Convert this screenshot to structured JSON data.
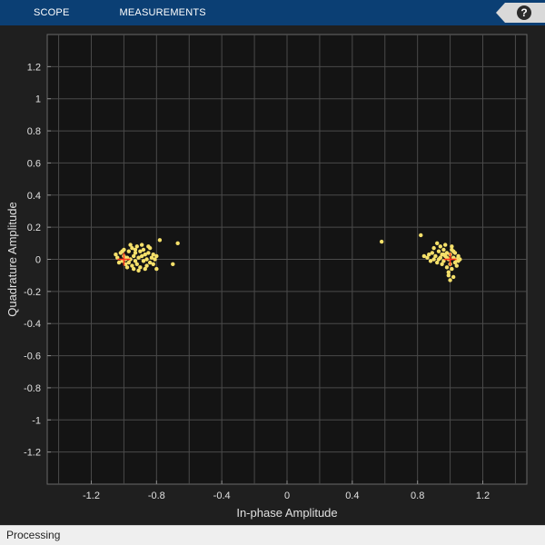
{
  "toolbar": {
    "tabs": [
      {
        "label": "SCOPE"
      },
      {
        "label": "MEASUREMENTS"
      }
    ],
    "help_label": "?",
    "help_icon": "help-icon"
  },
  "status": {
    "text": "Processing"
  },
  "colors": {
    "toolbar_bg": "#0b3f74",
    "plot_bg": "#141414",
    "figure_bg": "#1f1f1f",
    "grid": "#4a4a4a",
    "axis_text": "#e0e0e0",
    "points": "#f5e06a",
    "reference": "#ff3b1f"
  },
  "chart_data": {
    "type": "scatter",
    "xlabel": "In-phase Amplitude",
    "ylabel": "Quadrature Amplitude",
    "xlim": [
      -1.47,
      1.47
    ],
    "ylim": [
      -1.4,
      1.4
    ],
    "xticks": [
      -1.2,
      -0.8,
      -0.4,
      0,
      0.4,
      0.8,
      1.2
    ],
    "xtick_labels": [
      "-1.2",
      "-0.8",
      "-0.4",
      "0",
      "0.4",
      "0.8",
      "1.2"
    ],
    "yticks": [
      1.2,
      1,
      0.8,
      0.6,
      0.4,
      0.2,
      0,
      -0.2,
      -0.4,
      -0.6,
      -0.8,
      -1,
      -1.2
    ],
    "ytick_labels": [
      "1.2",
      "1",
      "0.8",
      "0.6",
      "0.4",
      "0.2",
      "0",
      "-0.2",
      "-0.4",
      "-0.6",
      "-0.8",
      "-1",
      "-1.2"
    ],
    "xgrid": [
      -1.4,
      -1.2,
      -1.0,
      -0.8,
      -0.6,
      -0.4,
      -0.2,
      0,
      0.2,
      0.4,
      0.6,
      0.8,
      1.0,
      1.2,
      1.4
    ],
    "ygrid": [
      1.2,
      1.0,
      0.8,
      0.6,
      0.4,
      0.2,
      0,
      -0.2,
      -0.4,
      -0.6,
      -0.8,
      -1.0,
      -1.2
    ],
    "grid": true,
    "reference_points": [
      [
        -1,
        0
      ],
      [
        1,
        0
      ]
    ],
    "points": [
      [
        -1.05,
        0.03
      ],
      [
        -1.04,
        0.01
      ],
      [
        -1.03,
        -0.02
      ],
      [
        -1.02,
        0.04
      ],
      [
        -1.01,
        -0.01
      ],
      [
        -1.0,
        0.02
      ],
      [
        -0.99,
        -0.03
      ],
      [
        -0.98,
        0.01
      ],
      [
        -0.97,
        0.05
      ],
      [
        -0.97,
        -0.02
      ],
      [
        -0.96,
        0.0
      ],
      [
        -0.95,
        0.07
      ],
      [
        -0.95,
        -0.04
      ],
      [
        -0.94,
        0.02
      ],
      [
        -0.93,
        -0.01
      ],
      [
        -0.93,
        0.04
      ],
      [
        -0.92,
        0.08
      ],
      [
        -0.92,
        -0.03
      ],
      [
        -0.91,
        0.01
      ],
      [
        -0.9,
        0.05
      ],
      [
        -0.9,
        -0.05
      ],
      [
        -0.89,
        0.02
      ],
      [
        -0.88,
        -0.01
      ],
      [
        -0.88,
        0.06
      ],
      [
        -0.87,
        0.03
      ],
      [
        -0.86,
        -0.04
      ],
      [
        -0.86,
        0.0
      ],
      [
        -0.85,
        0.04
      ],
      [
        -0.84,
        -0.02
      ],
      [
        -0.84,
        0.07
      ],
      [
        -0.83,
        0.01
      ],
      [
        -0.82,
        -0.03
      ],
      [
        -0.82,
        0.03
      ],
      [
        -0.81,
        0.0
      ],
      [
        -0.8,
        0.02
      ],
      [
        -0.8,
        -0.06
      ],
      [
        -0.98,
        -0.05
      ],
      [
        -1.0,
        0.06
      ],
      [
        -0.96,
        0.09
      ],
      [
        -0.94,
        -0.06
      ],
      [
        -0.89,
        0.09
      ],
      [
        -0.91,
        -0.07
      ],
      [
        -0.87,
        -0.06
      ],
      [
        -0.85,
        0.08
      ],
      [
        -0.78,
        0.12
      ],
      [
        -0.7,
        -0.03
      ],
      [
        -0.67,
        0.1
      ],
      [
        -0.99,
        0.0
      ],
      [
        -1.01,
        0.05
      ],
      [
        -0.93,
        0.06
      ],
      [
        0.82,
        0.15
      ],
      [
        0.84,
        0.02
      ],
      [
        0.86,
        0.01
      ],
      [
        0.87,
        0.03
      ],
      [
        0.88,
        -0.01
      ],
      [
        0.89,
        0.04
      ],
      [
        0.9,
        0.07
      ],
      [
        0.9,
        0.0
      ],
      [
        0.91,
        0.02
      ],
      [
        0.92,
        0.1
      ],
      [
        0.92,
        -0.02
      ],
      [
        0.93,
        0.05
      ],
      [
        0.94,
        0.01
      ],
      [
        0.94,
        0.08
      ],
      [
        0.95,
        -0.03
      ],
      [
        0.95,
        0.03
      ],
      [
        0.96,
        0.06
      ],
      [
        0.96,
        -0.01
      ],
      [
        0.97,
        0.02
      ],
      [
        0.97,
        0.09
      ],
      [
        0.98,
        -0.05
      ],
      [
        0.98,
        0.04
      ],
      [
        0.99,
        0.0
      ],
      [
        0.99,
        -0.08
      ],
      [
        1.0,
        0.03
      ],
      [
        1.0,
        -0.03
      ],
      [
        1.01,
        0.06
      ],
      [
        1.01,
        -0.06
      ],
      [
        1.02,
        0.01
      ],
      [
        1.02,
        -0.11
      ],
      [
        1.03,
        0.04
      ],
      [
        1.03,
        -0.02
      ],
      [
        1.04,
        0.0
      ],
      [
        1.04,
        -0.04
      ],
      [
        1.05,
        0.02
      ],
      [
        1.05,
        -0.01
      ],
      [
        1.06,
        0.0
      ],
      [
        1.0,
        -0.13
      ],
      [
        0.99,
        -0.1
      ],
      [
        1.01,
        0.08
      ],
      [
        0.93,
        0.0
      ],
      [
        0.96,
        0.03
      ],
      [
        0.98,
        0.01
      ],
      [
        1.02,
        0.05
      ],
      [
        0.58,
        0.11
      ]
    ]
  }
}
